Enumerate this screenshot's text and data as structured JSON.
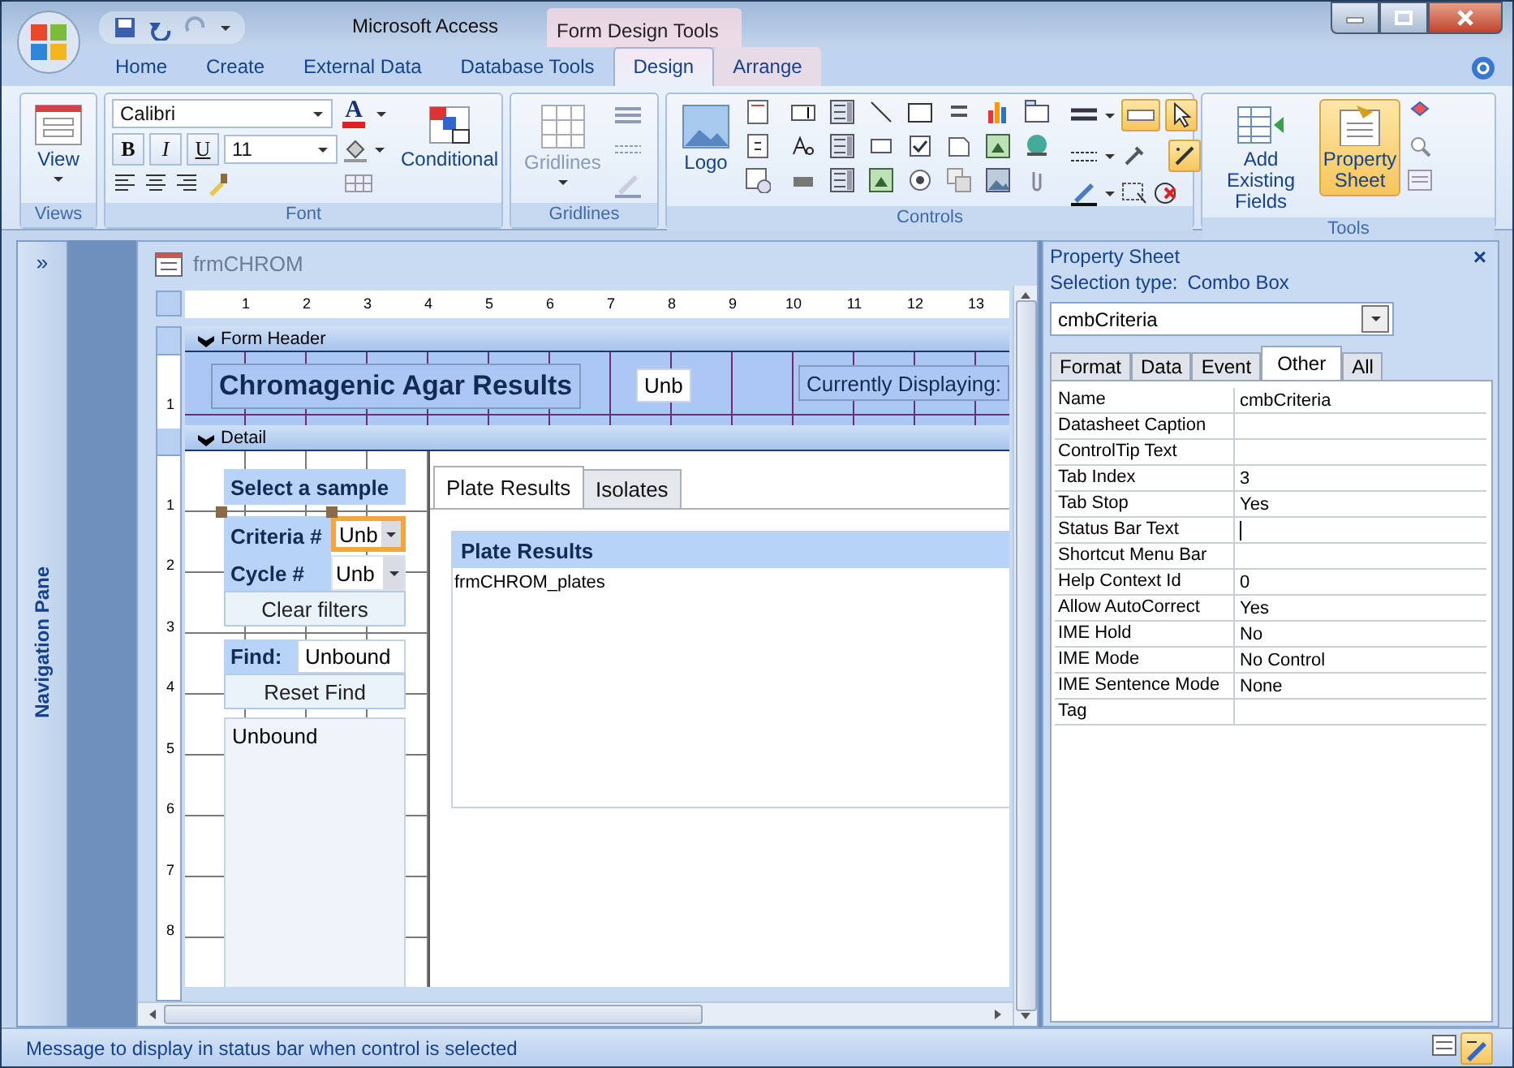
{
  "window": {
    "title": "Microsoft Access",
    "context_group": "Form Design Tools"
  },
  "ribbon_tabs": [
    {
      "label": "Home",
      "selected": false
    },
    {
      "label": "Create",
      "selected": false
    },
    {
      "label": "External Data",
      "selected": false
    },
    {
      "label": "Database Tools",
      "selected": false
    },
    {
      "label": "Design",
      "selected": true,
      "contextual": true
    },
    {
      "label": "Arrange",
      "selected": false,
      "contextual": true
    }
  ],
  "ribbon": {
    "views": {
      "label": "Views",
      "view_button": "View"
    },
    "font": {
      "label": "Font",
      "font_name": "Calibri",
      "font_size": "11",
      "bold": "B",
      "italic": "I",
      "underline": "U",
      "font_color_glyph": "A",
      "conditional_button": "Conditional"
    },
    "gridlines": {
      "label": "Gridlines",
      "gridlines_button": "Gridlines"
    },
    "controls": {
      "label": "Controls",
      "logo_button": "Logo",
      "select_pressed": true,
      "wizards_pressed": true,
      "insert_pressed": true
    },
    "tools": {
      "label": "Tools",
      "buttons": [
        {
          "label": "Add Existing Fields",
          "selected": false
        },
        {
          "label": "Property Sheet",
          "selected": true
        }
      ]
    }
  },
  "navigation_pane": {
    "expand_glyph": "»",
    "title": "Navigation Pane"
  },
  "form": {
    "title": "frmCHROM",
    "ruler_numbers": [
      "1",
      "2",
      "3",
      "4",
      "5",
      "6",
      "7",
      "8",
      "9",
      "10",
      "11",
      "12",
      "13"
    ],
    "sections": [
      {
        "label": "Form Header",
        "kind": "header",
        "ruler_numbers": [
          "1"
        ]
      },
      {
        "label": "Detail",
        "kind": "detail",
        "ruler_numbers": [
          "1",
          "2",
          "3",
          "4",
          "5",
          "6",
          "7",
          "8"
        ]
      }
    ],
    "header": {
      "title_label": "Chromagenic Agar Results",
      "text_box": "Unb",
      "status_label": "Currently Displaying:"
    },
    "detail": {
      "select_label": "Select a sample",
      "combos": [
        {
          "label": "Criteria #",
          "value": "Unb",
          "selected": true
        },
        {
          "label": "Cycle #",
          "value": "Unb",
          "selected": false
        }
      ],
      "clear_button": "Clear filters",
      "find_label": "Find:",
      "find_value": "Unbound",
      "reset_button": "Reset Find",
      "list_box": "Unbound",
      "tabs": [
        {
          "label": "Plate Results",
          "selected": true
        },
        {
          "label": "Isolates",
          "selected": false
        }
      ],
      "subform": {
        "label": "Plate Results",
        "source": "frmCHROM_plates"
      }
    }
  },
  "property_sheet": {
    "title": "Property Sheet",
    "close_glyph": "×",
    "selection_label": "Selection type:",
    "selection_type": "Combo Box",
    "object": "cmbCriteria",
    "tabs": [
      {
        "label": "Format",
        "selected": false
      },
      {
        "label": "Data",
        "selected": false
      },
      {
        "label": "Event",
        "selected": false
      },
      {
        "label": "Other",
        "selected": true
      },
      {
        "label": "All",
        "selected": false
      }
    ],
    "rows": [
      {
        "name": "Name",
        "value": "cmbCriteria",
        "editing": false
      },
      {
        "name": "Datasheet Caption",
        "value": "",
        "editing": false
      },
      {
        "name": "ControlTip Text",
        "value": "",
        "editing": false
      },
      {
        "name": "Tab Index",
        "value": "3",
        "editing": false
      },
      {
        "name": "Tab Stop",
        "value": "Yes",
        "editing": false
      },
      {
        "name": "Status Bar Text",
        "value": "",
        "editing": true
      },
      {
        "name": "Shortcut Menu Bar",
        "value": "",
        "editing": false
      },
      {
        "name": "Help Context Id",
        "value": "0",
        "editing": false
      },
      {
        "name": "Allow AutoCorrect",
        "value": "Yes",
        "editing": false
      },
      {
        "name": "IME Hold",
        "value": "No",
        "editing": false
      },
      {
        "name": "IME Mode",
        "value": "No Control",
        "editing": false
      },
      {
        "name": "IME Sentence Mode",
        "value": "None",
        "editing": false
      },
      {
        "name": "Tag",
        "value": "",
        "editing": false
      }
    ]
  },
  "status_bar": {
    "message": "Message to display in status bar when control is selected"
  }
}
